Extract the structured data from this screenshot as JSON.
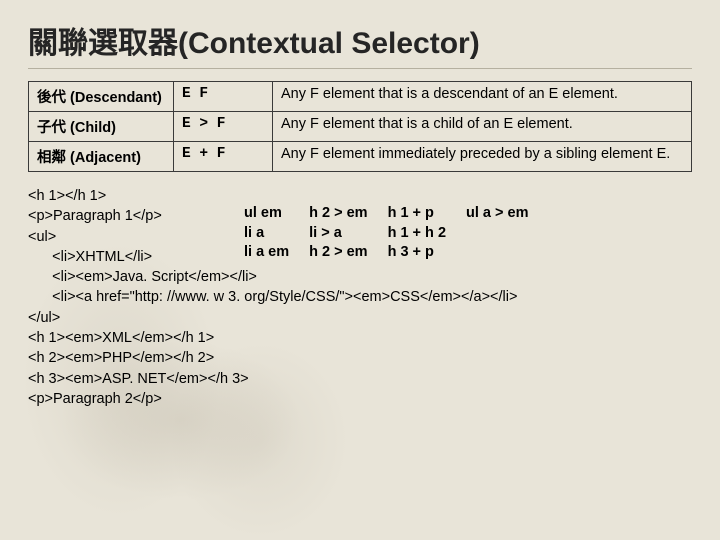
{
  "title": "關聯選取器(Contextual  Selector)",
  "rows": [
    {
      "name": "後代 (Descendant)",
      "syntax": "E  F",
      "desc": "Any F element that is a descendant of an E element."
    },
    {
      "name": "子代 (Child)",
      "syntax": "E > F",
      "desc": "Any F element that is a child of an E element."
    },
    {
      "name": "相鄰 (Adjacent)",
      "syntax": "E + F",
      "desc": "Any F element immediately preceded by a sibling element E."
    }
  ],
  "examples": {
    "c1": [
      "ul em",
      "li a",
      "li a em"
    ],
    "c2": [
      "h 2 > em",
      "li > a",
      "h 2 > em"
    ],
    "c3": [
      "h 1 + p",
      "h 1 + h 2",
      "h 3 + p"
    ],
    "c4": [
      "ul  a > em"
    ]
  },
  "code": "<h 1></h 1>\n<p>Paragraph 1</p>\n<ul>\n      <li>XHTML</li>\n      <li><em>Java. Script</em></li>\n      <li><a href=\"http: //www. w 3. org/Style/CSS/\"><em>CSS</em></a></li>\n</ul>\n<h 1><em>XML</em></h 1>\n<h 2><em>PHP</em></h 2>\n<h 3><em>ASP. NET</em></h 3>\n<p>Paragraph 2</p>"
}
